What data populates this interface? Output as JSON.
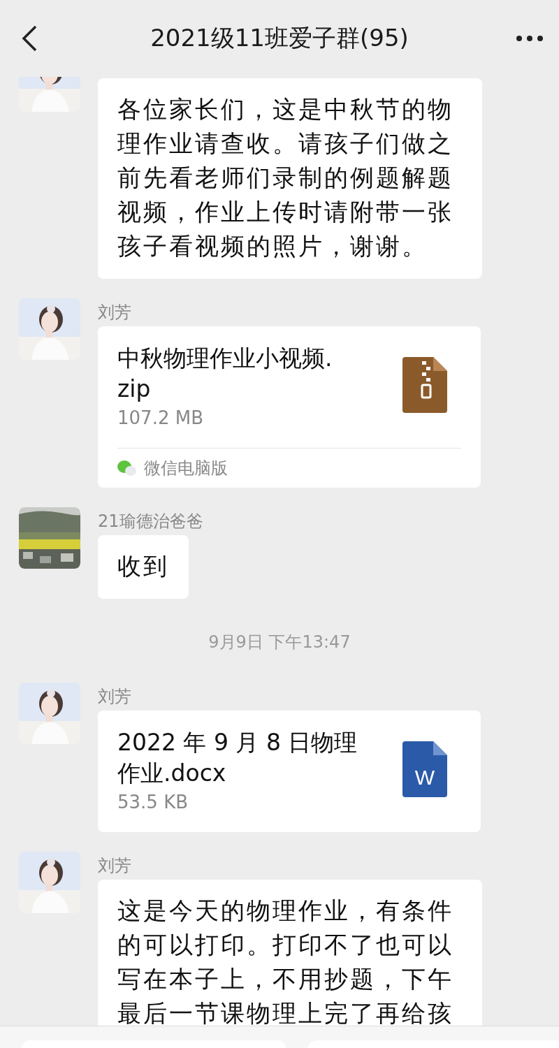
{
  "header": {
    "title": "2021级11班爱子群(95)"
  },
  "messages": [
    {
      "kind": "text",
      "avatar": {
        "kind": "figure"
      },
      "text": "各位家长们，这是中秋节的物理作业请查收。请孩子们做之前先看老师们录制的例题解题视频，作业上传时请附带一张孩子看视频的照片，谢谢。"
    },
    {
      "kind": "file",
      "avatar": {
        "kind": "figure"
      },
      "sender": "刘芳",
      "icon": {
        "kind": "zip"
      },
      "title": "中秋物理作业小视频.\nzip",
      "size": "107.2 MB",
      "source": "微信电脑版"
    },
    {
      "kind": "text",
      "avatar": {
        "kind": "landscape"
      },
      "sender": "21瑜德治爸爸",
      "text": "收到"
    },
    {
      "kind": "time",
      "text": "9月9日 下午13:47"
    },
    {
      "kind": "file",
      "avatar": {
        "kind": "figure"
      },
      "sender": "刘芳",
      "icon": {
        "kind": "docx",
        "text": "W"
      },
      "title": "2022 年 9 月 8 日物理作业.docx",
      "size": "53.5 KB"
    },
    {
      "kind": "text",
      "avatar": {
        "kind": "figure"
      },
      "sender": "刘芳",
      "text": "这是今天的物理作业，有条件的可以打印。打印不了也可以写在本子上，不用抄题，下午最后一节课物理上完了再给孩"
    }
  ]
}
